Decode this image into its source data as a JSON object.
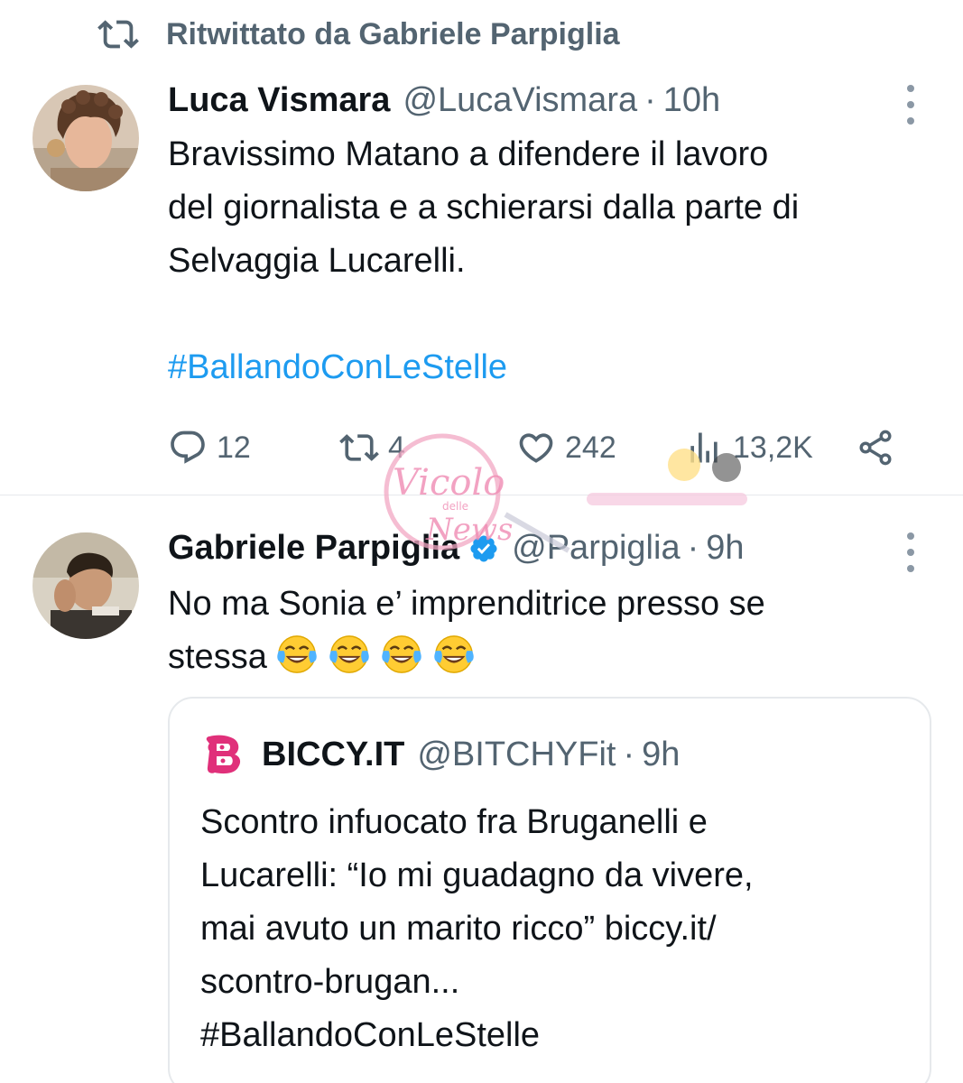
{
  "retweet_header": {
    "label": "Ritwittato da Gabriele Parpiglia",
    "icon": "retweet-icon"
  },
  "tweets": [
    {
      "display_name": "Luca Vismara",
      "handle": "@LucaVismara",
      "separator": "·",
      "time": "10h",
      "verified": false,
      "text_lines": [
        "Bravissimo Matano a difendere il lavoro",
        "del giornalista e a schierarsi dalla parte di",
        "Selvaggia Lucarelli."
      ],
      "hashtag": "#BallandoConLeStelle",
      "actions": {
        "replies": "12",
        "retweets": "4",
        "likes": "242",
        "views": "13,2K"
      }
    },
    {
      "display_name": "Gabriele Parpiglia",
      "handle": "@Parpiglia",
      "separator": "·",
      "time": "9h",
      "verified": true,
      "text_lines": [
        "No ma Sonia e’ imprenditrice presso se",
        "stessa"
      ],
      "emoji": [
        "face-with-tears-of-joy",
        "face-with-tears-of-joy",
        "face-with-tears-of-joy",
        "face-with-tears-of-joy"
      ],
      "quote": {
        "display_name": "BICCY.IT",
        "handle": "@BITCHYFit",
        "separator": "·",
        "time": "9h",
        "text_lines": [
          "Scontro infuocato fra Bruganelli e",
          "Lucarelli: “Io mi guadagno da vivere,",
          "mai avuto un marito ricco” biccy.it/",
          "scontro-brugan...",
          "#BallandoConLeStelle"
        ]
      }
    }
  ],
  "colors": {
    "text": "#0f1419",
    "secondary": "#536471",
    "link": "#1d9bf0",
    "verified": "#1d9bf0",
    "border": "#e6e9ec",
    "biccy_pink": "#e0307a"
  },
  "watermark": {
    "text_main": "Vicolo",
    "text_small": "delle",
    "text_bottom": "News"
  }
}
